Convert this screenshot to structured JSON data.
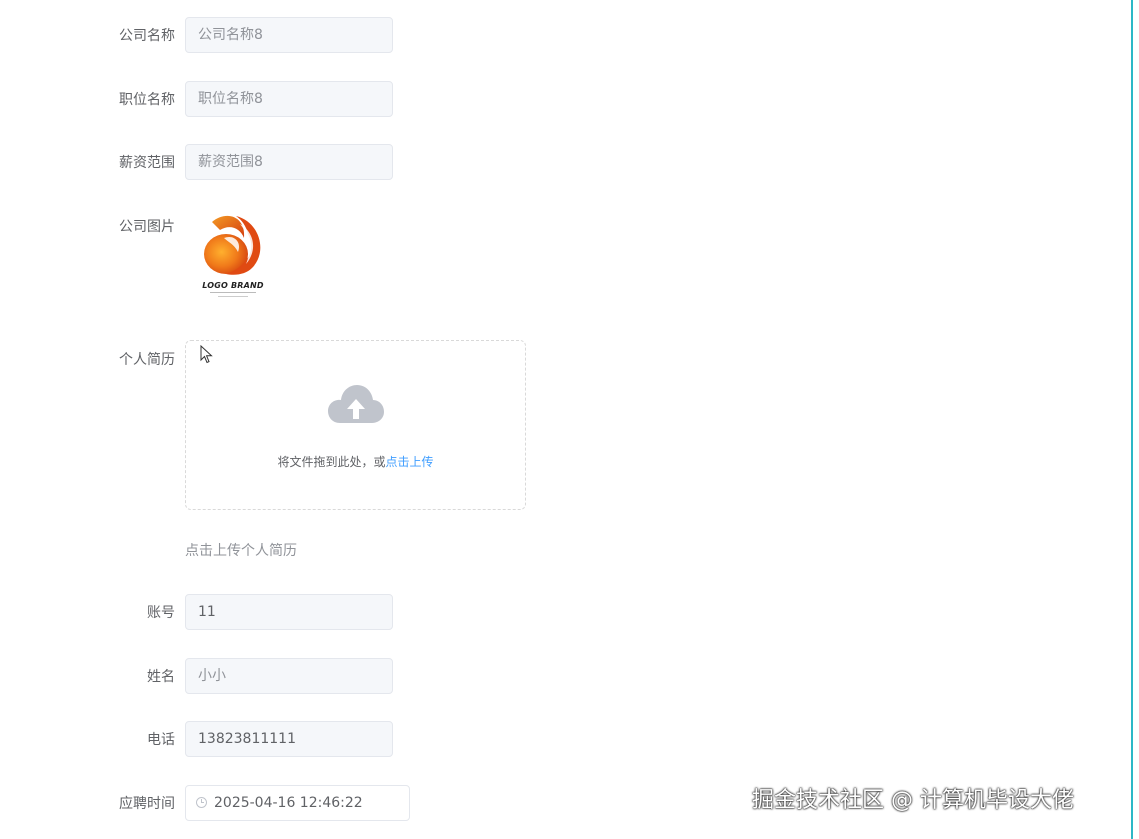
{
  "form": {
    "company_name": {
      "label": "公司名称",
      "value": "公司名称8"
    },
    "position_name": {
      "label": "职位名称",
      "value": "职位名称8"
    },
    "salary_range": {
      "label": "薪资范围",
      "value": "薪资范围8"
    },
    "company_image": {
      "label": "公司图片",
      "logo_text": "LOGO BRAND"
    },
    "resume": {
      "label": "个人简历",
      "upload_text": "将文件拖到此处，或",
      "upload_link": "点击上传",
      "tip": "点击上传个人简历"
    },
    "account": {
      "label": "账号",
      "value": "11"
    },
    "name": {
      "label": "姓名",
      "value": "小小"
    },
    "phone": {
      "label": "电话",
      "value": "13823811111"
    },
    "apply_time": {
      "label": "应聘时间",
      "value": "2025-04-16 12:46:22"
    }
  },
  "icons": {
    "upload": "cloud-upload-icon",
    "clock": "clock-icon",
    "cursor": "mouse-pointer-icon"
  },
  "colors": {
    "accent": "#409eff",
    "logo_orange": "#e8571b",
    "right_edge": "#2db7c6"
  },
  "watermark": "掘金技术社区 @ 计算机毕设大佬"
}
